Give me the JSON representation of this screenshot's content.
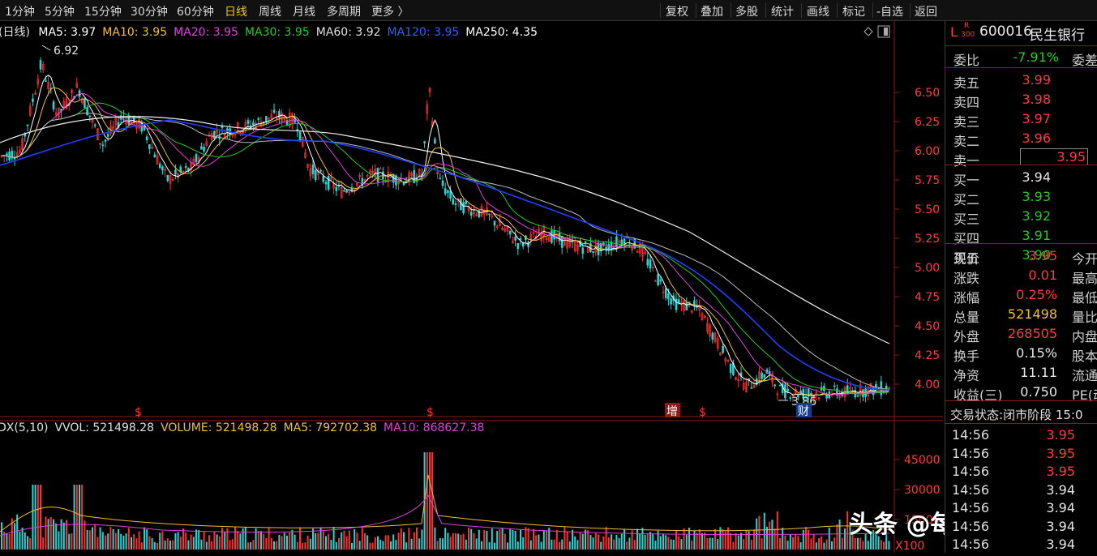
{
  "toolbar": {
    "periods": [
      "1分钟",
      "5分钟",
      "15分钟",
      "30分钟",
      "60分钟",
      "日线",
      "周线",
      "月线",
      "多周期",
      "更多 〉"
    ],
    "active_period": "日线",
    "tools": [
      "复权",
      "叠加",
      "多股",
      "统计",
      "画线",
      "标记",
      "-自选",
      "返回"
    ]
  },
  "ma_legend": {
    "prefix": "(日线)",
    "items": [
      {
        "text": "MA5: 3.97",
        "color": "#ffffff"
      },
      {
        "text": "MA10: 3.95",
        "color": "#f0c030"
      },
      {
        "text": "MA20: 3.95",
        "color": "#e040e0"
      },
      {
        "text": "MA30: 3.95",
        "color": "#22cc22"
      },
      {
        "text": "MA60: 3.92",
        "color": "#e0e0e0"
      },
      {
        "text": "MA120: 3.95",
        "color": "#3060ff"
      },
      {
        "text": "MA250: 4.35",
        "color": "#ffffff"
      }
    ]
  },
  "volume_legend": {
    "items": [
      {
        "text": "DX(5,10)",
        "color": "#e0e0e0"
      },
      {
        "text": "VVOL: 521498.28",
        "color": "#e0e0e0"
      },
      {
        "text": "VOLUME: 521498.28",
        "color": "#f0c030"
      },
      {
        "text": "MA5: 792702.38",
        "color": "#f0c030"
      },
      {
        "text": "MA10: 868627.38",
        "color": "#e040e0"
      }
    ]
  },
  "price_axis": {
    "ticks": [
      "6.50",
      "6.25",
      "6.00",
      "5.75",
      "5.50",
      "5.25",
      "5.00",
      "4.75",
      "4.50",
      "4.25",
      "4.00"
    ]
  },
  "volume_axis": {
    "ticks": [
      "45000",
      "30000",
      "15000"
    ],
    "unit": "X100"
  },
  "annotations": {
    "high": "6.92",
    "low": "3.86",
    "markers": [
      "$",
      "$",
      "增",
      "$",
      "财"
    ]
  },
  "stock": {
    "flag": "L",
    "index_tag_top": "R",
    "index_tag_bottom": "300",
    "code": "600016",
    "name": "民生银行"
  },
  "order_ratio": {
    "label": "委比",
    "value": "-7.91%",
    "label2": "委差"
  },
  "sell_orders": [
    {
      "label": "卖五",
      "price": "3.99"
    },
    {
      "label": "卖四",
      "price": "3.98"
    },
    {
      "label": "卖三",
      "price": "3.97"
    },
    {
      "label": "卖二",
      "price": "3.96"
    },
    {
      "label": "卖一",
      "price": "3.95"
    }
  ],
  "buy_orders": [
    {
      "label": "买一",
      "price": "3.94"
    },
    {
      "label": "买二",
      "price": "3.93"
    },
    {
      "label": "买三",
      "price": "3.92"
    },
    {
      "label": "买四",
      "price": "3.91"
    },
    {
      "label": "买五",
      "price": "3.90"
    }
  ],
  "stats": [
    {
      "label": "现价",
      "value": "3.95",
      "label2": "今开"
    },
    {
      "label": "涨跌",
      "value": "0.01",
      "label2": "最高"
    },
    {
      "label": "涨幅",
      "value": "0.25%",
      "label2": "最低"
    },
    {
      "label": "总量",
      "value": "521498",
      "label2": "量比"
    },
    {
      "label": "外盘",
      "value": "268505",
      "label2": "内盘"
    },
    {
      "label": "换手",
      "value": "0.15%",
      "label2": "股本"
    },
    {
      "label": "净资",
      "value": "11.11",
      "label2": "流通"
    },
    {
      "label": "收益(三)",
      "value": "0.750",
      "label2": "PE(动"
    }
  ],
  "trade_status": {
    "label": "交易状态:",
    "value": "闭市阶段",
    "time": "15:0"
  },
  "ticks": [
    {
      "time": "14:56",
      "price": "3.95"
    },
    {
      "time": "14:56",
      "price": "3.95"
    },
    {
      "time": "14:56",
      "price": "3.95"
    },
    {
      "time": "14:56",
      "price": "3.94"
    },
    {
      "time": "14:56",
      "price": "3.94"
    },
    {
      "time": "14:56",
      "price": "3.94"
    },
    {
      "time": "14:56",
      "price": "3.94"
    }
  ],
  "watermark": "头条 @每日资本论"
}
